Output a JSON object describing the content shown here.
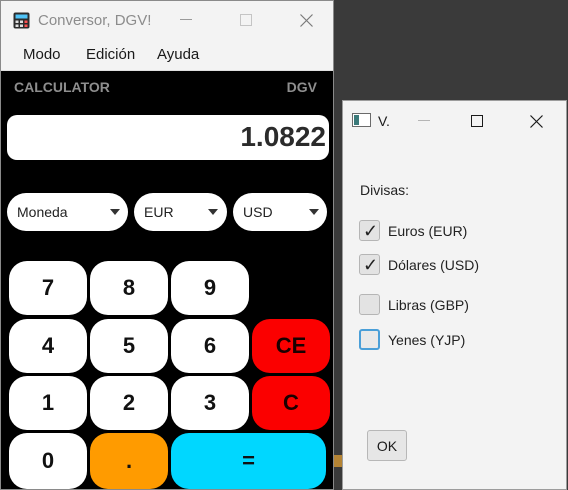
{
  "main_window": {
    "title": "Conversor, DGV!",
    "menu": [
      "Modo",
      "Edición",
      "Ayuda"
    ],
    "header": {
      "left": "CALCULATOR",
      "right": "DGV"
    },
    "display": "1.0822",
    "combos": [
      {
        "value": "Moneda"
      },
      {
        "value": "EUR"
      },
      {
        "value": "USD"
      }
    ],
    "keys": {
      "k7": "7",
      "k8": "8",
      "k9": "9",
      "k4": "4",
      "k5": "5",
      "k6": "6",
      "ce": "CE",
      "k1": "1",
      "k2": "2",
      "k3": "3",
      "c": "C",
      "k0": "0",
      "dot": ".",
      "eq": "="
    },
    "colors": {
      "background": "#000000",
      "clear": "#fb0000",
      "dot": "#ff9b00",
      "equals": "#00d7ff"
    }
  },
  "dialog": {
    "title": "V.",
    "section": "Divisas:",
    "options": [
      {
        "label": "Euros (EUR)",
        "checked": true
      },
      {
        "label": "Dólares (USD)",
        "checked": true
      },
      {
        "label": "Libras (GBP)",
        "checked": false
      },
      {
        "label": "Yenes (YJP)",
        "checked": false
      }
    ],
    "ok": "OK"
  }
}
